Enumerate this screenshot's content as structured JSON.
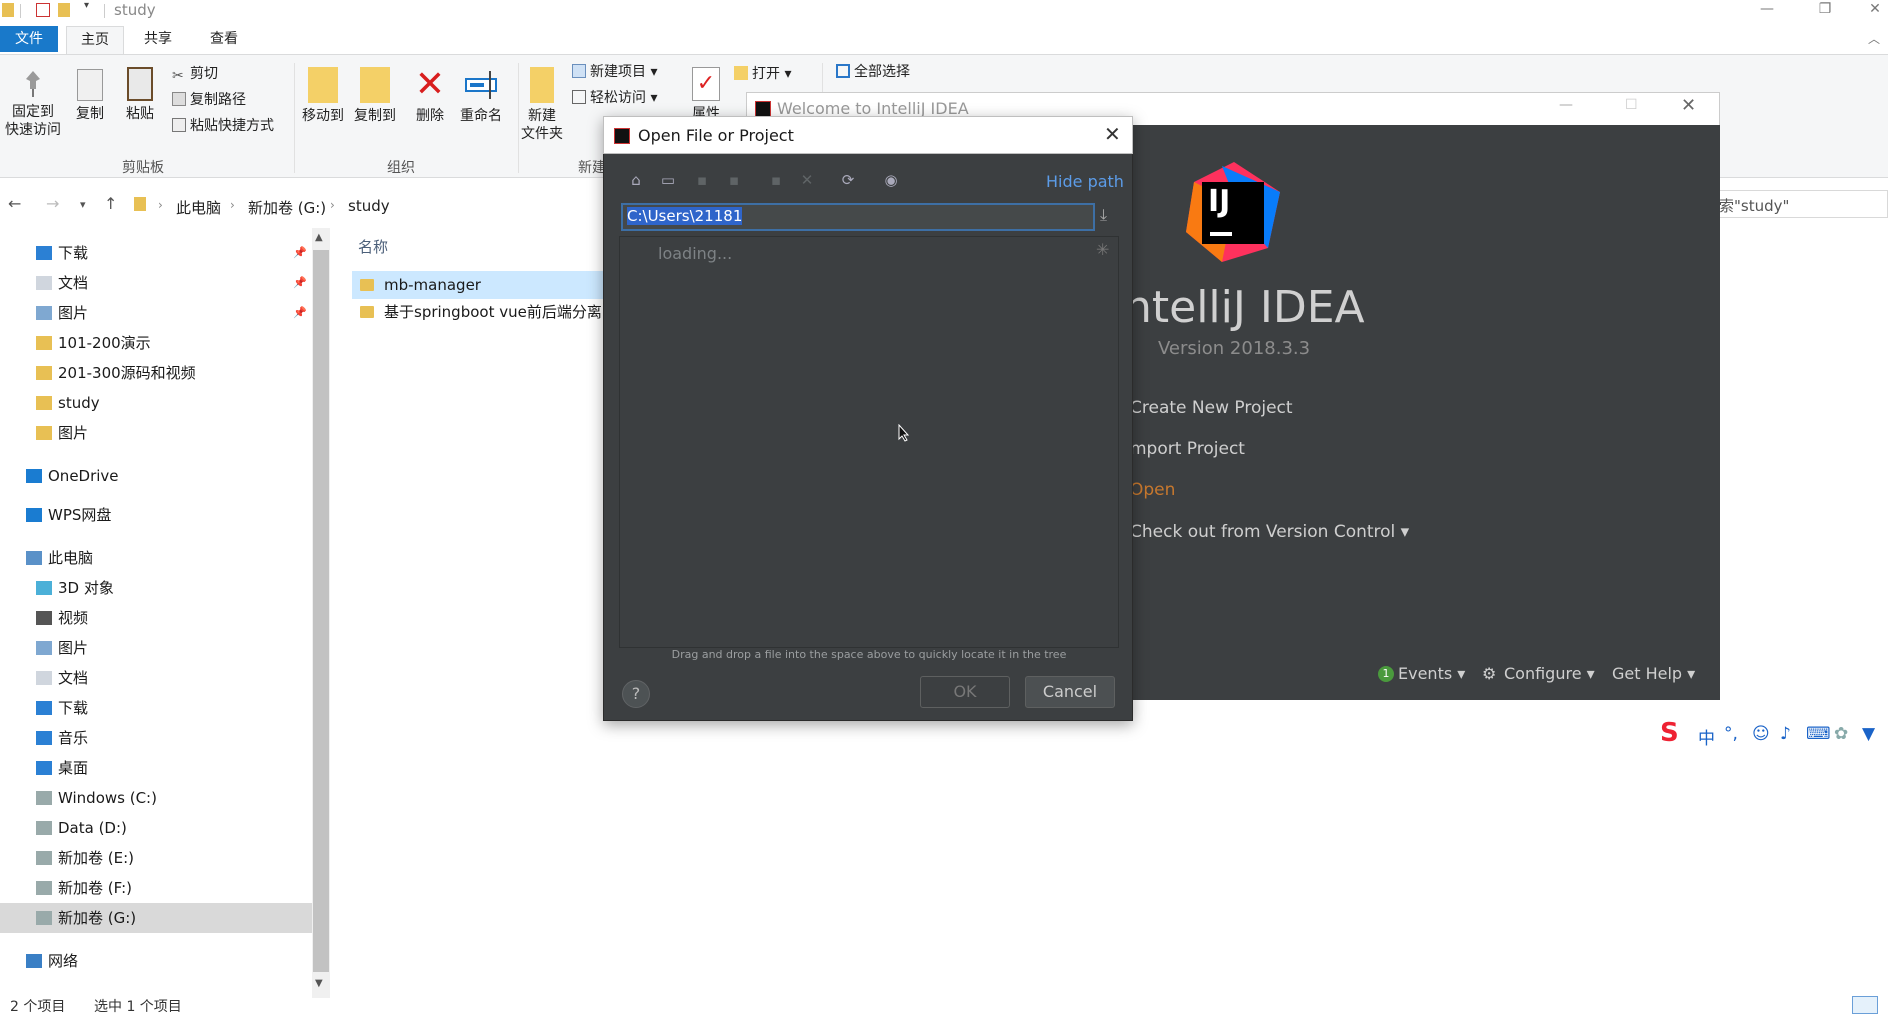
{
  "explorer": {
    "window_title": "study",
    "window_controls": {
      "minimize": "—",
      "restore": "❐",
      "close": "✕"
    },
    "tabs": [
      "文件",
      "主页",
      "共享",
      "查看"
    ],
    "ribbon": {
      "pin_label_1": "固定到",
      "pin_label_2": "快速访问",
      "copy": "复制",
      "paste": "粘贴",
      "cut": "剪切",
      "copy_path": "复制路径",
      "paste_shortcut": "粘贴快捷方式",
      "group_clipboard": "剪贴板",
      "move_to": "移动到",
      "copy_to": "复制到",
      "delete": "删除",
      "rename": "重命名",
      "group_organize": "组织",
      "new_folder_1": "新建",
      "new_folder_2": "文件夹",
      "new_item": "新建项目",
      "easy_access": "轻松访问",
      "group_new": "新建",
      "properties": "属性",
      "open": "打开",
      "select_all": "全部选择"
    },
    "breadcrumb": [
      "此电脑",
      "新加卷 (G:)",
      "study"
    ],
    "search_placeholder": "索\"study\"",
    "sidebar": [
      {
        "label": "下载",
        "icon": "download-icon",
        "pinned": true
      },
      {
        "label": "文档",
        "icon": "document-icon",
        "pinned": true
      },
      {
        "label": "图片",
        "icon": "picture-icon",
        "pinned": true
      },
      {
        "label": "101-200演示",
        "icon": "folder-icon"
      },
      {
        "label": "201-300源码和视频",
        "icon": "folder-icon"
      },
      {
        "label": "study",
        "icon": "folder-icon"
      },
      {
        "label": "图片",
        "icon": "folder-icon"
      },
      {
        "label": "OneDrive",
        "icon": "cloud-icon"
      },
      {
        "label": "WPS网盘",
        "icon": "cloud-icon"
      },
      {
        "label": "此电脑",
        "icon": "computer-icon"
      },
      {
        "label": "3D 对象",
        "icon": "cube-icon"
      },
      {
        "label": "视频",
        "icon": "video-icon"
      },
      {
        "label": "图片",
        "icon": "picture-icon"
      },
      {
        "label": "文档",
        "icon": "document-icon"
      },
      {
        "label": "下载",
        "icon": "download-icon"
      },
      {
        "label": "音乐",
        "icon": "music-icon"
      },
      {
        "label": "桌面",
        "icon": "desktop-icon"
      },
      {
        "label": "Windows (C:)",
        "icon": "drive-icon"
      },
      {
        "label": "Data (D:)",
        "icon": "drive-icon"
      },
      {
        "label": "新加卷 (E:)",
        "icon": "drive-icon"
      },
      {
        "label": "新加卷 (F:)",
        "icon": "drive-icon"
      },
      {
        "label": "新加卷 (G:)",
        "icon": "drive-icon",
        "selected": true
      },
      {
        "label": "网络",
        "icon": "network-icon"
      }
    ],
    "column_name": "名称",
    "files": [
      {
        "name": "mb-manager",
        "selected": true
      },
      {
        "name": "基于springboot vue前后端分离"
      }
    ],
    "status": {
      "count": "2 个项目",
      "selected": "选中 1 个项目"
    }
  },
  "intellij": {
    "window_title": "Welcome to IntelliJ IDEA",
    "product": "ntelliJ IDEA",
    "version": "Version 2018.3.3",
    "actions": [
      "Create New Project",
      "mport Project",
      "Open",
      "Check out from Version Control ▾"
    ],
    "footer": {
      "events_count": "1",
      "events": "Events ▾",
      "configure": "Configure ▾",
      "help": "Get Help ▾"
    },
    "logo_text": "IJ"
  },
  "dialog": {
    "title": "Open File or Project",
    "hide_path": "Hide path",
    "path": "C:\\Users\\21181",
    "loading": "loading...",
    "hint": "Drag and drop a file into the space above to quickly locate it in the tree",
    "help": "?",
    "ok": "OK",
    "cancel": "Cancel"
  },
  "ime": {
    "lang": "中",
    "punct": "°,"
  }
}
